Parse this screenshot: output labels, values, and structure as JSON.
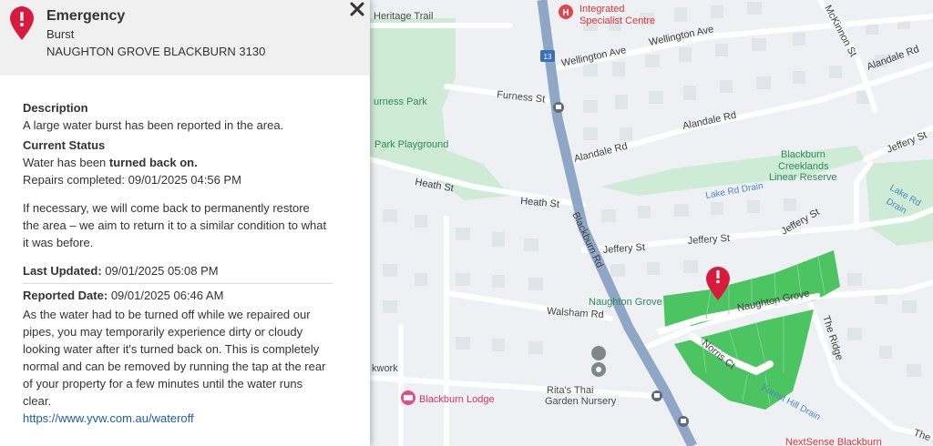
{
  "panel": {
    "header": {
      "title": "Emergency",
      "type": "Burst",
      "address": "NAUGHTON GROVE BLACKBURN 3130"
    },
    "close_icon": "close-icon",
    "description_label": "Description",
    "description_text": "A large water burst has been reported in the area.",
    "status_label": "Current Status",
    "status_prefix": "Water has been ",
    "status_bold": "turned back on.",
    "repairs_text": "Repairs completed: 09/01/2025 04:56 PM",
    "restore_text": "If necessary, we will come back to permanently restore the area – we aim to return it to a similar condition to what it was before.",
    "last_updated_label": "Last Updated:",
    "last_updated_value": "09/01/2025 05:08 PM",
    "reported_label": "Reported Date:",
    "reported_value": "09/01/2025 06:46 AM",
    "water_info": "As the water had to be turned off while we repaired our pipes, you may temporarily experience dirty or cloudy looking water after it's turned back on. This is completely normal and can be removed by running the tap at the rear of your property for a few minutes until the water runs clear.",
    "link_text": "https://www.yvw.com.au/wateroff"
  },
  "map": {
    "labels": {
      "heritage_trail": "Heritage Trail",
      "integrated": "Integrated",
      "specialist": "Specialist Centre",
      "wellington_ave_1": "Wellington Ave",
      "wellington_ave_2": "Wellington Ave",
      "mckinnon": "McKinnon St",
      "alandale_rd_1": "Alandale Rd",
      "alandale_rd_2": "Alandale Rd",
      "alandale_rd_3": "Alandale Rd",
      "furness_st": "Furness St",
      "furness_park": "urness Park",
      "park_playground": "Park Playground",
      "creeklands_1": "Blackburn",
      "creeklands_2": "Creeklands",
      "creeklands_3": "Linear Reserve",
      "jeffery_st_1": "Jeffery St",
      "jeffery_st_2": "Jeffery St",
      "jeffery_st_3": "Jeffery St",
      "jeffery_st_4": "Jeffery St",
      "heath_st_1": "Heath St",
      "heath_st_2": "Heath St",
      "lake_rd_drain_1": "Lake Rd Drain",
      "lake_rd_drain_2": "Lake Rd",
      "lake_rd_drain_3": "Drain",
      "blackburn_rd": "Blackburn Rd",
      "naughton_grove_1": "Naughton Grove",
      "naughton_grove_2": "Naughton Grove",
      "walsham_rd": "Walsham Rd",
      "the_ridge": "The Ridge",
      "norris_ct": "Norris Ct",
      "ritas_1": "Rita's Thai",
      "ritas_2": "Garden Nursery",
      "blackburn_lodge": "Blackburn Lodge",
      "forest_hill_drain": "Forest Hill Drain",
      "kwork": "kwork",
      "nextsense": "NextSense Blackburn",
      "route_13": "13",
      "the_fragment": "The"
    }
  },
  "colors": {
    "accent_red": "#d81b3c",
    "affected_area": "#4cc462",
    "park": "#cdebd5",
    "main_road": "#8fa7c7",
    "link": "#1a5ea8"
  }
}
